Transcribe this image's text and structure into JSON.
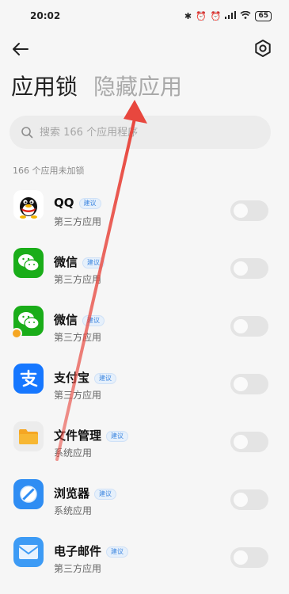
{
  "status_bar": {
    "time": "20:02",
    "icons": [
      "bluetooth-icon",
      "alarm-off-icon",
      "alarm-icon",
      "signal-icon",
      "wifi-icon"
    ],
    "battery": "65"
  },
  "tabs": [
    {
      "label": "应用锁",
      "active": true
    },
    {
      "label": "隐藏应用",
      "active": false
    }
  ],
  "search": {
    "placeholder": "搜索 166 个应用程序"
  },
  "section_label": "166 个应用未加锁",
  "badge_label": "建议",
  "apps": [
    {
      "name": "QQ",
      "subtitle": "第三方应用",
      "icon": "qq-icon",
      "badge": true,
      "locked": false
    },
    {
      "name": "微信",
      "subtitle": "第三方应用",
      "icon": "wechat-icon",
      "badge": true,
      "locked": false
    },
    {
      "name": "微信",
      "subtitle": "第三方应用",
      "icon": "wechat-dual-icon",
      "badge": true,
      "locked": false
    },
    {
      "name": "支付宝",
      "subtitle": "第三方应用",
      "icon": "alipay-icon",
      "badge": true,
      "locked": false
    },
    {
      "name": "文件管理",
      "subtitle": "系统应用",
      "icon": "file-manager-icon",
      "badge": true,
      "locked": false
    },
    {
      "name": "浏览器",
      "subtitle": "系统应用",
      "icon": "browser-icon",
      "badge": true,
      "locked": false
    },
    {
      "name": "电子邮件",
      "subtitle": "第三方应用",
      "icon": "email-icon",
      "badge": true,
      "locked": false
    }
  ],
  "colors": {
    "accent": "#3d86e0",
    "annotation_arrow": "#e8473e",
    "wechat": "#1aad19",
    "alipay": "#1677ff",
    "file_manager": "#f5a623"
  }
}
